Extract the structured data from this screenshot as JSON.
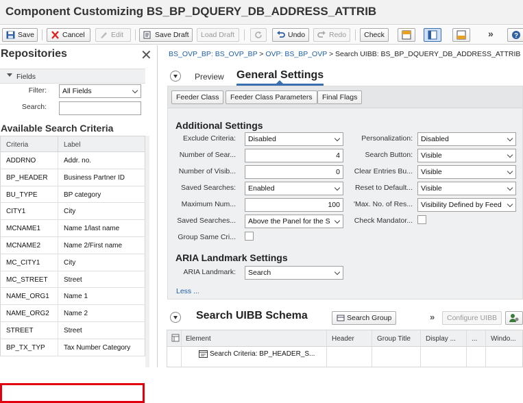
{
  "window": {
    "title": "Component Customizing BS_BP_DQUERY_DB_ADDRESS_ATTRIB"
  },
  "toolbar": {
    "save": "Save",
    "cancel": "Cancel",
    "edit": "Edit",
    "save_draft": "Save Draft",
    "load_draft": "Load Draft",
    "undo": "Undo",
    "redo": "Redo",
    "check": "Check",
    "more": "»"
  },
  "repositories": {
    "title": "Repositories",
    "fields_header": "Fields",
    "filter_label": "Filter:",
    "filter_value": "All Fields",
    "search_label": "Search:",
    "search_value": "",
    "available_title": "Available Search Criteria",
    "columns": [
      "Criteria",
      "Label"
    ],
    "rows": [
      [
        "ADDRNO",
        "Addr. no."
      ],
      [
        "BP_HEADER",
        "Business Partner ID"
      ],
      [
        "BU_TYPE",
        "BP category"
      ],
      [
        "CITY1",
        "City"
      ],
      [
        "MCNAME1",
        "Name 1/last name"
      ],
      [
        "MCNAME2",
        "Name 2/First name"
      ],
      [
        "MC_CITY1",
        "City"
      ],
      [
        "MC_STREET",
        "Street"
      ],
      [
        "NAME_ORG1",
        "Name 1"
      ],
      [
        "NAME_ORG2",
        "Name 2"
      ],
      [
        "STREET",
        "Street"
      ],
      [
        "BP_TX_TYP",
        "Tax Number Category"
      ]
    ]
  },
  "breadcrumb": {
    "link1": "BS_OVP_BP: BS_OVP_BP",
    "sep1": " > ",
    "link2": "OVP: BS_BP_OVP",
    "rest": " > Search UIBB: BS_BP_DQUERY_DB_ADDRESS_ATTRIB"
  },
  "tabs": {
    "preview": "Preview",
    "general": "General Settings"
  },
  "subtoolbar": {
    "feeder_class": "Feeder Class",
    "feeder_params": "Feeder Class Parameters",
    "final_flags": "Final Flags"
  },
  "additional": {
    "title": "Additional Settings",
    "exclude_label": "Exclude Criteria:",
    "exclude_value": "Disabled",
    "num_search_label": "Number of Sear...",
    "num_search_value": "4",
    "num_visible_label": "Number of Visib...",
    "num_visible_value": "0",
    "saved_label": "Saved Searches:",
    "saved_value": "Enabled",
    "max_label": "Maximum Num...",
    "max_value": "100",
    "saved_pos_label": "Saved Searches...",
    "saved_pos_value": "Above the Panel for the S",
    "group_label": "Group Same Cri...",
    "personalization_label": "Personalization:",
    "personalization_value": "Disabled",
    "search_button_label": "Search Button:",
    "search_button_value": "Visible",
    "clear_label": "Clear Entries Bu...",
    "clear_value": "Visible",
    "reset_label": "Reset to Default...",
    "reset_value": "Visible",
    "max_res_label": "'Max. No. of Res...",
    "max_res_value": "Visibility Defined by Feed",
    "check_mand_label": "Check Mandator..."
  },
  "aria": {
    "title": "ARIA Landmark Settings",
    "label": "ARIA Landmark:",
    "value": "Search",
    "less": "Less ..."
  },
  "schema": {
    "title": "Search UIBB Schema",
    "search_group": "Search Group",
    "more": "»",
    "configure": "Configure UIBB",
    "columns": [
      "Element",
      "Header",
      "Group Title",
      "Display ...",
      "...",
      "Windo..."
    ],
    "row1": "Search Criteria: BP_HEADER_S..."
  }
}
